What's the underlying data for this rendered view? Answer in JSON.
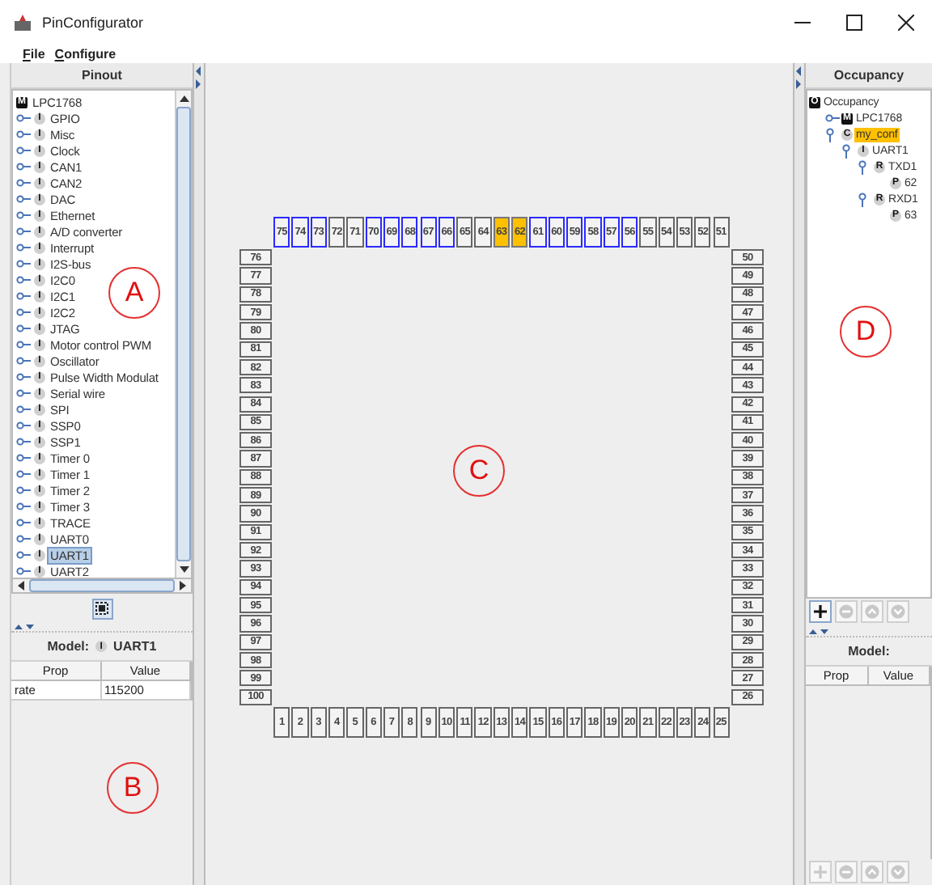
{
  "window": {
    "title": "PinConfigurator"
  },
  "menu": [
    {
      "label": "File"
    },
    {
      "label": "Configure"
    }
  ],
  "pinout_panel": {
    "title": "Pinout",
    "tree": {
      "label": "LPC1768",
      "badge": "M",
      "kind": "square",
      "children": [
        {
          "label": "GPIO",
          "badge": "I",
          "expanded": false,
          "selected": false
        },
        {
          "label": "Misc",
          "badge": "I",
          "expanded": false,
          "selected": false
        },
        {
          "label": "Clock",
          "badge": "I",
          "expanded": false,
          "selected": false
        },
        {
          "label": "CAN1",
          "badge": "I",
          "expanded": false,
          "selected": false
        },
        {
          "label": "CAN2",
          "badge": "I",
          "expanded": false,
          "selected": false
        },
        {
          "label": "DAC",
          "badge": "I",
          "expanded": false,
          "selected": false
        },
        {
          "label": "Ethernet",
          "badge": "I",
          "expanded": false,
          "selected": false
        },
        {
          "label": "A/D converter",
          "badge": "I",
          "expanded": false,
          "selected": false
        },
        {
          "label": "Interrupt",
          "badge": "I",
          "expanded": false,
          "selected": false
        },
        {
          "label": "I2S-bus",
          "badge": "I",
          "expanded": false,
          "selected": false
        },
        {
          "label": "I2C0",
          "badge": "I",
          "expanded": false,
          "selected": false
        },
        {
          "label": "I2C1",
          "badge": "I",
          "expanded": false,
          "selected": false
        },
        {
          "label": "I2C2",
          "badge": "I",
          "expanded": false,
          "selected": false
        },
        {
          "label": "JTAG",
          "badge": "I",
          "expanded": false,
          "selected": false
        },
        {
          "label": "Motor control PWM",
          "badge": "I",
          "expanded": false,
          "selected": false
        },
        {
          "label": "Oscillator",
          "badge": "I",
          "expanded": false,
          "selected": false
        },
        {
          "label": "Pulse Width Modulat",
          "badge": "I",
          "expanded": false,
          "selected": false
        },
        {
          "label": "Serial wire",
          "badge": "I",
          "expanded": false,
          "selected": false
        },
        {
          "label": "SPI",
          "badge": "I",
          "expanded": false,
          "selected": false
        },
        {
          "label": "SSP0",
          "badge": "I",
          "expanded": false,
          "selected": false
        },
        {
          "label": "SSP1",
          "badge": "I",
          "expanded": false,
          "selected": false
        },
        {
          "label": "Timer 0",
          "badge": "I",
          "expanded": false,
          "selected": false
        },
        {
          "label": "Timer 1",
          "badge": "I",
          "expanded": false,
          "selected": false
        },
        {
          "label": "Timer 2",
          "badge": "I",
          "expanded": false,
          "selected": false
        },
        {
          "label": "Timer 3",
          "badge": "I",
          "expanded": false,
          "selected": false
        },
        {
          "label": "TRACE",
          "badge": "I",
          "expanded": false,
          "selected": false
        },
        {
          "label": "UART0",
          "badge": "I",
          "expanded": false,
          "selected": false
        },
        {
          "label": "UART1",
          "badge": "I",
          "expanded": false,
          "selected": true
        },
        {
          "label": "UART2",
          "badge": "I",
          "expanded": false,
          "selected": false
        }
      ]
    },
    "model": {
      "label": "Model:",
      "badge": "I",
      "name": "UART1"
    },
    "table": {
      "columns": [
        "Prop",
        "Value"
      ],
      "rows": [
        [
          "rate",
          "115200"
        ]
      ]
    }
  },
  "chip": {
    "top": [
      {
        "label": "75",
        "used": true,
        "selected": false
      },
      {
        "label": "74",
        "used": true,
        "selected": false
      },
      {
        "label": "73",
        "used": true,
        "selected": false
      },
      {
        "label": "72",
        "used": false,
        "selected": false
      },
      {
        "label": "71",
        "used": false,
        "selected": false
      },
      {
        "label": "70",
        "used": true,
        "selected": false
      },
      {
        "label": "69",
        "used": true,
        "selected": false
      },
      {
        "label": "68",
        "used": true,
        "selected": false
      },
      {
        "label": "67",
        "used": true,
        "selected": false
      },
      {
        "label": "66",
        "used": true,
        "selected": false
      },
      {
        "label": "65",
        "used": false,
        "selected": false
      },
      {
        "label": "64",
        "used": false,
        "selected": false
      },
      {
        "label": "63",
        "used": false,
        "selected": true
      },
      {
        "label": "62",
        "used": false,
        "selected": true
      },
      {
        "label": "61",
        "used": true,
        "selected": false
      },
      {
        "label": "60",
        "used": true,
        "selected": false
      },
      {
        "label": "59",
        "used": true,
        "selected": false
      },
      {
        "label": "58",
        "used": true,
        "selected": false
      },
      {
        "label": "57",
        "used": true,
        "selected": false
      },
      {
        "label": "56",
        "used": true,
        "selected": false
      },
      {
        "label": "55",
        "used": false,
        "selected": false
      },
      {
        "label": "54",
        "used": false,
        "selected": false
      },
      {
        "label": "53",
        "used": false,
        "selected": false
      },
      {
        "label": "52",
        "used": false,
        "selected": false
      },
      {
        "label": "51",
        "used": false,
        "selected": false
      }
    ],
    "left": [
      {
        "label": "76",
        "used": false,
        "selected": false
      },
      {
        "label": "77",
        "used": false,
        "selected": false
      },
      {
        "label": "78",
        "used": false,
        "selected": false
      },
      {
        "label": "79",
        "used": false,
        "selected": false
      },
      {
        "label": "80",
        "used": false,
        "selected": false
      },
      {
        "label": "81",
        "used": false,
        "selected": false
      },
      {
        "label": "82",
        "used": false,
        "selected": false
      },
      {
        "label": "83",
        "used": false,
        "selected": false
      },
      {
        "label": "84",
        "used": false,
        "selected": false
      },
      {
        "label": "85",
        "used": false,
        "selected": false
      },
      {
        "label": "86",
        "used": false,
        "selected": false
      },
      {
        "label": "87",
        "used": false,
        "selected": false
      },
      {
        "label": "88",
        "used": false,
        "selected": false
      },
      {
        "label": "89",
        "used": false,
        "selected": false
      },
      {
        "label": "90",
        "used": false,
        "selected": false
      },
      {
        "label": "91",
        "used": false,
        "selected": false
      },
      {
        "label": "92",
        "used": false,
        "selected": false
      },
      {
        "label": "93",
        "used": false,
        "selected": false
      },
      {
        "label": "94",
        "used": false,
        "selected": false
      },
      {
        "label": "95",
        "used": false,
        "selected": false
      },
      {
        "label": "96",
        "used": false,
        "selected": false
      },
      {
        "label": "97",
        "used": false,
        "selected": false
      },
      {
        "label": "98",
        "used": false,
        "selected": false
      },
      {
        "label": "99",
        "used": false,
        "selected": false
      },
      {
        "label": "100",
        "used": false,
        "selected": false
      }
    ],
    "right": [
      {
        "label": "50",
        "used": false,
        "selected": false
      },
      {
        "label": "49",
        "used": false,
        "selected": false
      },
      {
        "label": "48",
        "used": false,
        "selected": false
      },
      {
        "label": "47",
        "used": false,
        "selected": false
      },
      {
        "label": "46",
        "used": false,
        "selected": false
      },
      {
        "label": "45",
        "used": false,
        "selected": false
      },
      {
        "label": "44",
        "used": false,
        "selected": false
      },
      {
        "label": "43",
        "used": false,
        "selected": false
      },
      {
        "label": "42",
        "used": false,
        "selected": false
      },
      {
        "label": "41",
        "used": false,
        "selected": false
      },
      {
        "label": "40",
        "used": false,
        "selected": false
      },
      {
        "label": "39",
        "used": false,
        "selected": false
      },
      {
        "label": "38",
        "used": false,
        "selected": false
      },
      {
        "label": "37",
        "used": false,
        "selected": false
      },
      {
        "label": "36",
        "used": false,
        "selected": false
      },
      {
        "label": "35",
        "used": false,
        "selected": false
      },
      {
        "label": "34",
        "used": false,
        "selected": false
      },
      {
        "label": "33",
        "used": false,
        "selected": false
      },
      {
        "label": "32",
        "used": false,
        "selected": false
      },
      {
        "label": "31",
        "used": false,
        "selected": false
      },
      {
        "label": "30",
        "used": false,
        "selected": false
      },
      {
        "label": "29",
        "used": false,
        "selected": false
      },
      {
        "label": "28",
        "used": false,
        "selected": false
      },
      {
        "label": "27",
        "used": false,
        "selected": false
      },
      {
        "label": "26",
        "used": false,
        "selected": false
      }
    ],
    "bottom": [
      {
        "label": "1",
        "used": false,
        "selected": false
      },
      {
        "label": "2",
        "used": false,
        "selected": false
      },
      {
        "label": "3",
        "used": false,
        "selected": false
      },
      {
        "label": "4",
        "used": false,
        "selected": false
      },
      {
        "label": "5",
        "used": false,
        "selected": false
      },
      {
        "label": "6",
        "used": false,
        "selected": false
      },
      {
        "label": "7",
        "used": false,
        "selected": false
      },
      {
        "label": "8",
        "used": false,
        "selected": false
      },
      {
        "label": "9",
        "used": false,
        "selected": false
      },
      {
        "label": "10",
        "used": false,
        "selected": false
      },
      {
        "label": "11",
        "used": false,
        "selected": false
      },
      {
        "label": "12",
        "used": false,
        "selected": false
      },
      {
        "label": "13",
        "used": false,
        "selected": false
      },
      {
        "label": "14",
        "used": false,
        "selected": false
      },
      {
        "label": "15",
        "used": false,
        "selected": false
      },
      {
        "label": "16",
        "used": false,
        "selected": false
      },
      {
        "label": "17",
        "used": false,
        "selected": false
      },
      {
        "label": "18",
        "used": false,
        "selected": false
      },
      {
        "label": "19",
        "used": false,
        "selected": false
      },
      {
        "label": "20",
        "used": false,
        "selected": false
      },
      {
        "label": "21",
        "used": false,
        "selected": false
      },
      {
        "label": "22",
        "used": false,
        "selected": false
      },
      {
        "label": "23",
        "used": false,
        "selected": false
      },
      {
        "label": "24",
        "used": false,
        "selected": false
      },
      {
        "label": "25",
        "used": false,
        "selected": false
      }
    ]
  },
  "occupancy_panel": {
    "title": "Occupancy",
    "tree": [
      {
        "label": "Occupancy",
        "badge": "O",
        "kind": "square",
        "selected": false,
        "children": [
          {
            "label": "LPC1768",
            "badge": "M",
            "kind": "square",
            "expanded": false,
            "selected": false
          },
          {
            "label": "my_conf",
            "badge": "C",
            "expanded": true,
            "selected": true,
            "children": [
              {
                "label": "UART1",
                "badge": "I",
                "expanded": true,
                "selected": false,
                "children": [
                  {
                    "label": "TXD1",
                    "badge": "R",
                    "expanded": true,
                    "selected": false,
                    "children": [
                      {
                        "label": "62",
                        "badge": "P",
                        "selected": false
                      }
                    ]
                  },
                  {
                    "label": "RXD1",
                    "badge": "R",
                    "expanded": true,
                    "selected": false,
                    "children": [
                      {
                        "label": "63",
                        "badge": "P",
                        "selected": false
                      }
                    ]
                  }
                ]
              }
            ]
          }
        ]
      }
    ],
    "buttons": [
      {
        "kind": "plus",
        "disabled": false
      },
      {
        "kind": "minus",
        "disabled": true
      },
      {
        "kind": "up",
        "disabled": true
      },
      {
        "kind": "down",
        "disabled": true
      }
    ],
    "model": {
      "label": "Model:"
    },
    "table": {
      "columns": [
        "Prop",
        "Value"
      ]
    },
    "bottom_buttons": [
      {
        "kind": "plus",
        "disabled": true
      },
      {
        "kind": "minus",
        "disabled": true
      },
      {
        "kind": "up",
        "disabled": true
      },
      {
        "kind": "down",
        "disabled": true
      }
    ]
  },
  "annotations": [
    "A",
    "B",
    "C",
    "D"
  ]
}
